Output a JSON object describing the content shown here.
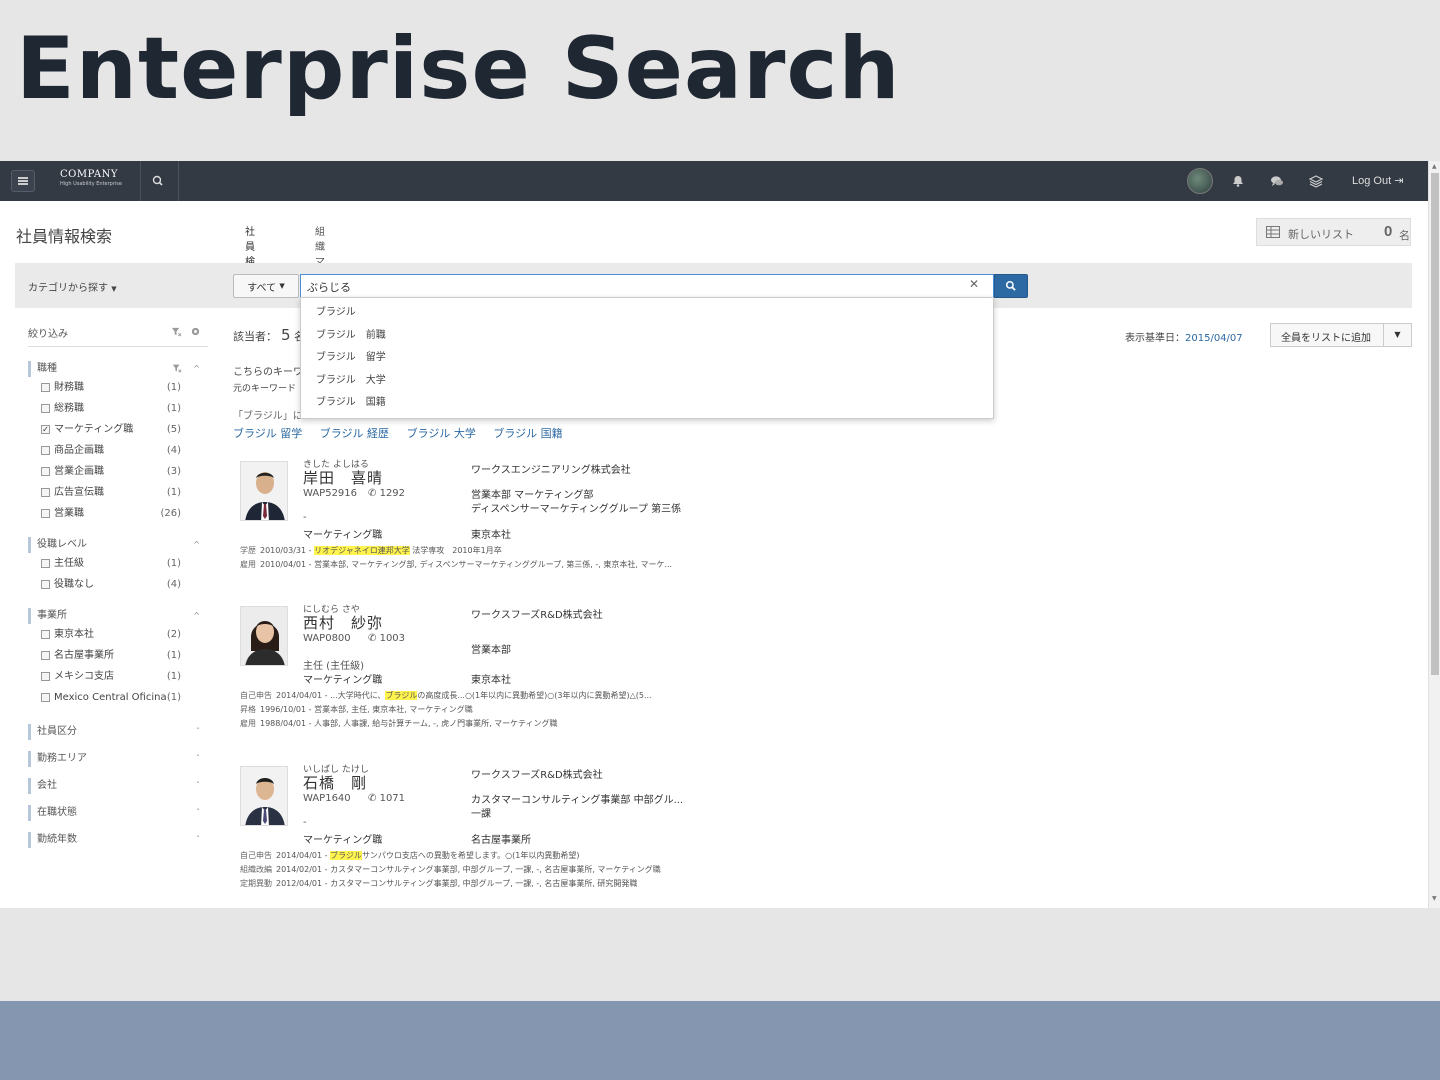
{
  "slide": {
    "title": "Enterprise Search"
  },
  "nav": {
    "logo_main": "COMPANY",
    "logo_sub": "High Usability Enterprise",
    "logout": "Log Out"
  },
  "header": {
    "page_title": "社員情報検索",
    "tabs": [
      {
        "label": "社員検索"
      },
      {
        "label": "組織マップ"
      }
    ],
    "new_list": {
      "label": "新しいリスト",
      "count": "0",
      "unit": "名"
    }
  },
  "search": {
    "category_link": "カテゴリから探す",
    "scope": "すべて",
    "query": "ぶらじる",
    "suggestions": [
      "ブラジル",
      "ブラジル　前職",
      "ブラジル　留学",
      "ブラジル　大学",
      "ブラジル　国籍"
    ]
  },
  "sidebar": {
    "filter_title": "絞り込み",
    "groups": [
      {
        "title": "職種",
        "items": [
          {
            "label": "財務職",
            "count": "(1)",
            "checked": false
          },
          {
            "label": "総務職",
            "count": "(1)",
            "checked": false
          },
          {
            "label": "マーケティング職",
            "count": "(5)",
            "checked": true
          },
          {
            "label": "商品企画職",
            "count": "(4)",
            "checked": false
          },
          {
            "label": "営業企画職",
            "count": "(3)",
            "checked": false
          },
          {
            "label": "広告宣伝職",
            "count": "(1)",
            "checked": false
          },
          {
            "label": "営業職",
            "count": "(26)",
            "checked": false
          }
        ]
      },
      {
        "title": "役職レベル",
        "items": [
          {
            "label": "主任級",
            "count": "(1)",
            "checked": false
          },
          {
            "label": "役職なし",
            "count": "(4)",
            "checked": false
          }
        ]
      },
      {
        "title": "事業所",
        "items": [
          {
            "label": "東京本社",
            "count": "(2)",
            "checked": false
          },
          {
            "label": "名古屋事業所",
            "count": "(1)",
            "checked": false
          },
          {
            "label": "メキシコ支店",
            "count": "(1)",
            "checked": false
          },
          {
            "label": "Mexico Central Oficina",
            "count": "(1)",
            "checked": false
          }
        ]
      }
    ],
    "collapsed_groups": [
      "社員区分",
      "勤務エリア",
      "会社",
      "在職状態",
      "勤続年数"
    ]
  },
  "results": {
    "hits_label": "該当者：",
    "hits_count": "5",
    "hits_unit": "名",
    "base_date_label": "表示基準日：",
    "base_date": "2015/04/07",
    "add_all": "全員をリストに追加",
    "kw_line1": "こちらのキーワード",
    "kw_line2": "元のキーワード",
    "kw_line3": "「ブラジル」に",
    "related": [
      "ブラジル 留学",
      "ブラジル 経歴",
      "ブラジル 大学",
      "ブラジル 国籍"
    ],
    "people": [
      {
        "kana": "きした よしはる",
        "name": "岸田　喜晴",
        "code": "WAP52916",
        "ext": "1292",
        "title": "-",
        "job": "マーケティング職",
        "company": "ワークスエンジニアリング株式会社",
        "dept1": "営業本部 マーケティング部",
        "dept2": "ディスペンサーマーケティンググループ 第三係",
        "office": "東京本社",
        "history": [
          {
            "key": "学歴",
            "pre": "2010/03/31 - ",
            "hl": "リオデジャネイロ連邦大学",
            "post": "法学専攻　2010年1月卒"
          },
          {
            "key": "雇用",
            "pre": "2010/04/01 - 営業本部, マーケティング部, ディスペンサーマーケティンググループ, 第三係, -, 東京本社, マーケ...",
            "hl": "",
            "post": ""
          }
        ]
      },
      {
        "kana": "にしむら さや",
        "name": "西村　紗弥",
        "code": "WAP0800",
        "ext": "1003",
        "title": "主任 (主任級)",
        "job": "マーケティング職",
        "company": "ワークスフーズR&D株式会社",
        "dept1": "営業本部",
        "dept2": "",
        "office": "東京本社",
        "history": [
          {
            "key": "自己申告",
            "pre": "2014/04/01 - ...大学時代に、",
            "hl": "ブラジル",
            "post": "の高度成長...○(1年以内に異動希望)○(3年以内に異動希望)△(5..."
          },
          {
            "key": "昇格",
            "pre": "1996/10/01 - 営業本部, 主任, 東京本社, マーケティング職",
            "hl": "",
            "post": ""
          },
          {
            "key": "雇用",
            "pre": "1988/04/01 - 人事部, 人事課, 給与計算チーム, -, 虎ノ門事業所, マーケティング職",
            "hl": "",
            "post": ""
          }
        ]
      },
      {
        "kana": "いしばし たけし",
        "name": "石橋　剛",
        "code": "WAP1640",
        "ext": "1071",
        "title": "-",
        "job": "マーケティング職",
        "company": "ワークスフーズR&D株式会社",
        "dept1": "カスタマーコンサルティング事業部 中部グル...",
        "dept2": "一課",
        "office": "名古屋事業所",
        "history": [
          {
            "key": "自己申告",
            "pre": "2014/04/01 - ",
            "hl": "ブラジル",
            "post": "サンパウロ支店への異動を希望します。○(1年以内異動希望)"
          },
          {
            "key": "組織改編",
            "pre": "2014/02/01 - カスタマーコンサルティング事業部, 中部グループ, 一課, -, 名古屋事業所, マーケティング職",
            "hl": "",
            "post": ""
          },
          {
            "key": "定期異動",
            "pre": "2012/04/01 - カスタマーコンサルティング事業部, 中部グループ, 一課, -, 名古屋事業所, 研究開発職",
            "hl": "",
            "post": ""
          }
        ]
      }
    ]
  },
  "colors": {
    "nav_bg": "#333a44",
    "accent": "#2d6aa3",
    "highlight": "#fff34d",
    "band": "#8496b0"
  }
}
